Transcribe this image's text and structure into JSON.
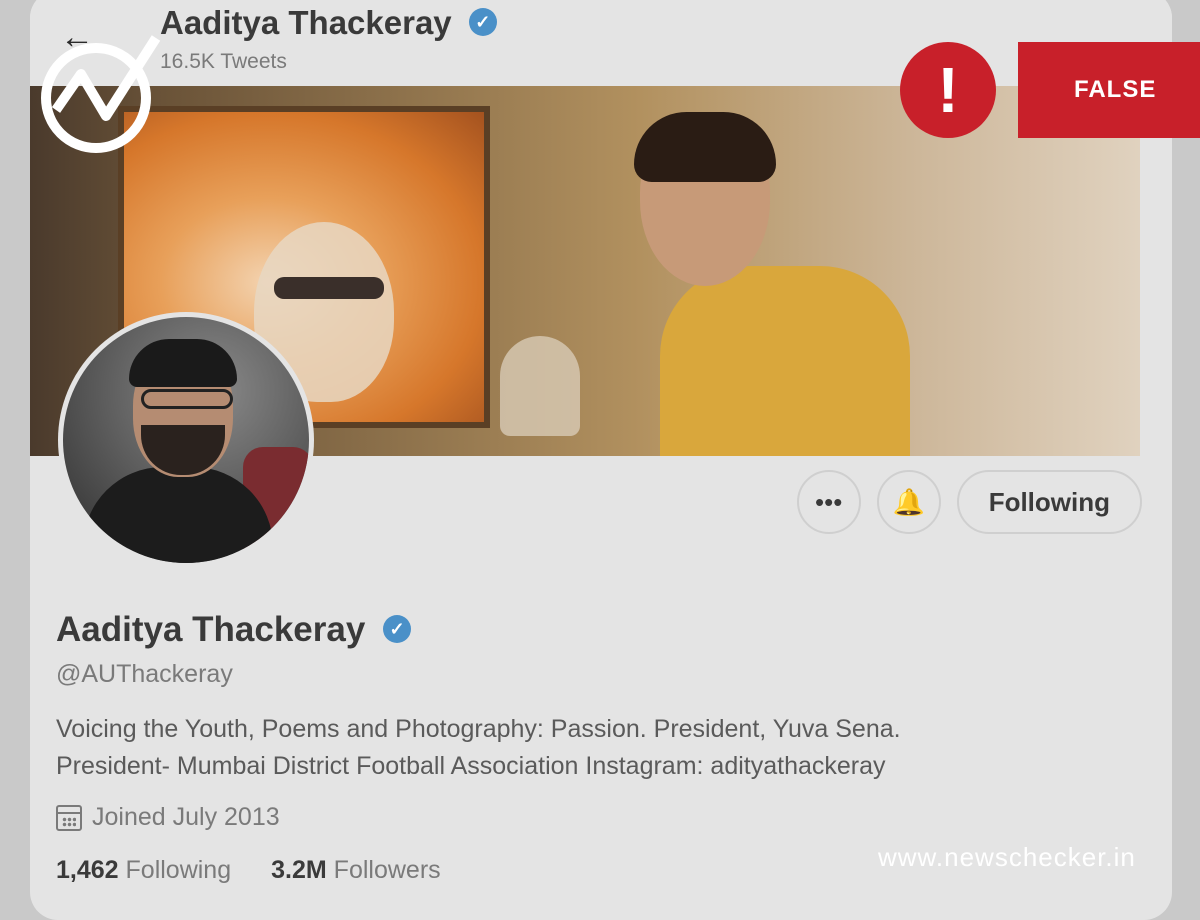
{
  "topbar": {
    "name": "Aaditya Thackeray",
    "tweets": "16.5K Tweets"
  },
  "actions": {
    "more_label": "•••",
    "notify_label": "🔔",
    "follow_label": "Following"
  },
  "profile": {
    "name": "Aaditya Thackeray",
    "handle": "@AUThackeray",
    "bio_line1": "Voicing the Youth, Poems and Photography: Passion. President, Yuva Sena.",
    "bio_line2": "President- Mumbai District Football Association Instagram: adityathackeray",
    "joined": "Joined July 2013",
    "following_count": "1,462",
    "following_label": "Following",
    "followers_count": "3.2M",
    "followers_label": "Followers"
  },
  "overlay": {
    "verdict": "FALSE",
    "alert_symbol": "!",
    "site": "www.newschecker.in",
    "brand_color": "#c8202a"
  }
}
